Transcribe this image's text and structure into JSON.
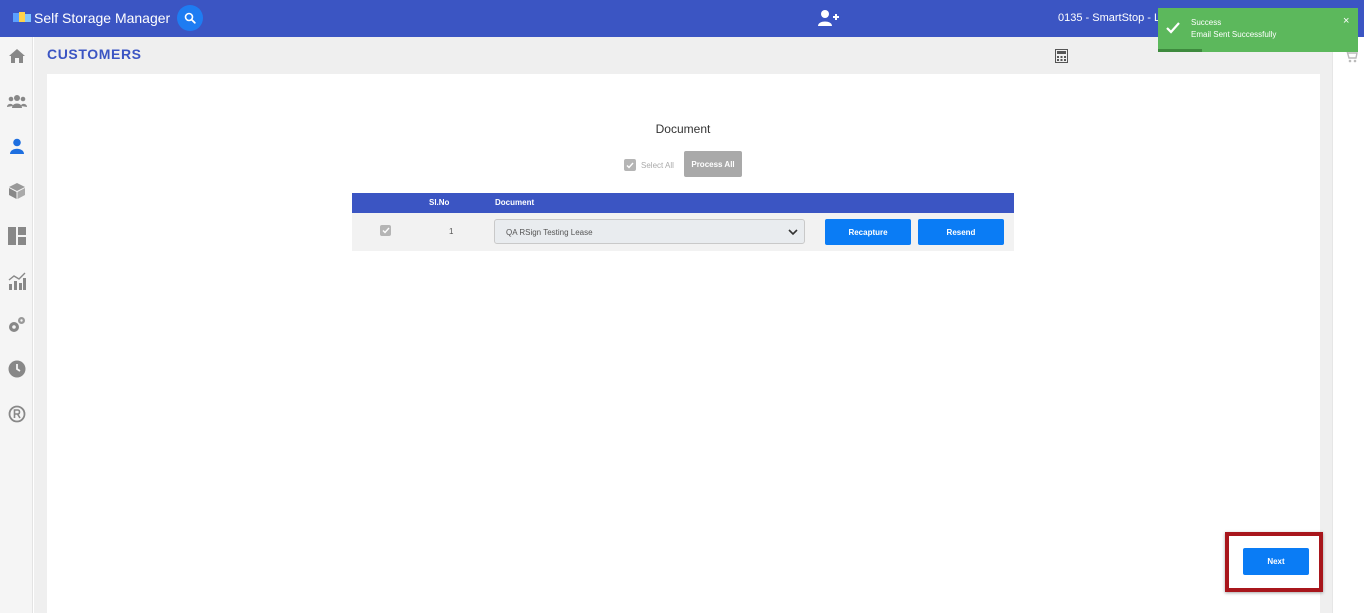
{
  "header": {
    "app_title": "Self Storage Manager",
    "location": "0135 - SmartStop - Los"
  },
  "page": {
    "title": "CUSTOMERS"
  },
  "document_panel": {
    "heading": "Document",
    "select_all_label": "Select All",
    "process_all_label": "Process All",
    "columns": [
      "Sl.No",
      "Document"
    ],
    "rows": [
      {
        "sl_no": "1",
        "document": "QA RSign Testing Lease",
        "checked": true,
        "recapture_label": "Recapture",
        "resend_label": "Resend"
      }
    ]
  },
  "footer": {
    "next_label": "Next"
  },
  "toast": {
    "title": "Success",
    "message": "Email Sent Successfully",
    "close_glyph": "×"
  },
  "colors": {
    "primary": "#3b55c3",
    "button_blue": "#0a7cf5",
    "success": "#5cb85c",
    "highlight_border": "#a8161c",
    "disabled_gray": "#a9a9a9"
  },
  "icons": {
    "sidebar": [
      "home-icon",
      "users-group-icon",
      "customer-icon",
      "box-icon",
      "dashboard-icon",
      "reports-icon",
      "settings-icon",
      "clock-icon",
      "registered-icon"
    ],
    "header": [
      "logo-icon",
      "search-icon",
      "add-user-icon"
    ],
    "other": [
      "calculator-icon",
      "cart-icon",
      "checkmark-icon"
    ]
  }
}
